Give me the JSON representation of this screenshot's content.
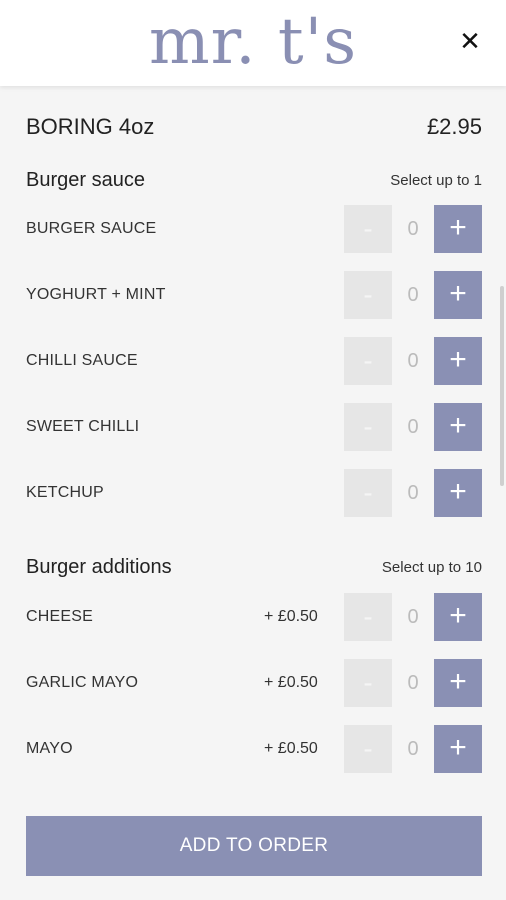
{
  "header": {
    "logo_text": "mr. t's",
    "close_symbol": "✕"
  },
  "item": {
    "name": "BORING 4oz",
    "price": "£2.95"
  },
  "groups": [
    {
      "title": "Burger sauce",
      "limit": "Select up to 1",
      "options": [
        {
          "name": "BURGER SAUCE",
          "price": "",
          "qty": "0"
        },
        {
          "name": "YOGHURT + MINT",
          "price": "",
          "qty": "0"
        },
        {
          "name": "CHILLI SAUCE",
          "price": "",
          "qty": "0"
        },
        {
          "name": "SWEET CHILLI",
          "price": "",
          "qty": "0"
        },
        {
          "name": "KETCHUP",
          "price": "",
          "qty": "0"
        }
      ]
    },
    {
      "title": "Burger additions",
      "limit": "Select up to 10",
      "options": [
        {
          "name": "CHEESE",
          "price": "+ £0.50",
          "qty": "0"
        },
        {
          "name": "GARLIC MAYO",
          "price": "+ £0.50",
          "qty": "0"
        },
        {
          "name": "MAYO",
          "price": "+ £0.50",
          "qty": "0"
        }
      ]
    }
  ],
  "stepper": {
    "minus_label": "-",
    "plus_label": "+"
  },
  "footer": {
    "add_label": "ADD TO ORDER"
  },
  "colors": {
    "accent": "#8a90b4",
    "background": "#f5f5f5"
  }
}
